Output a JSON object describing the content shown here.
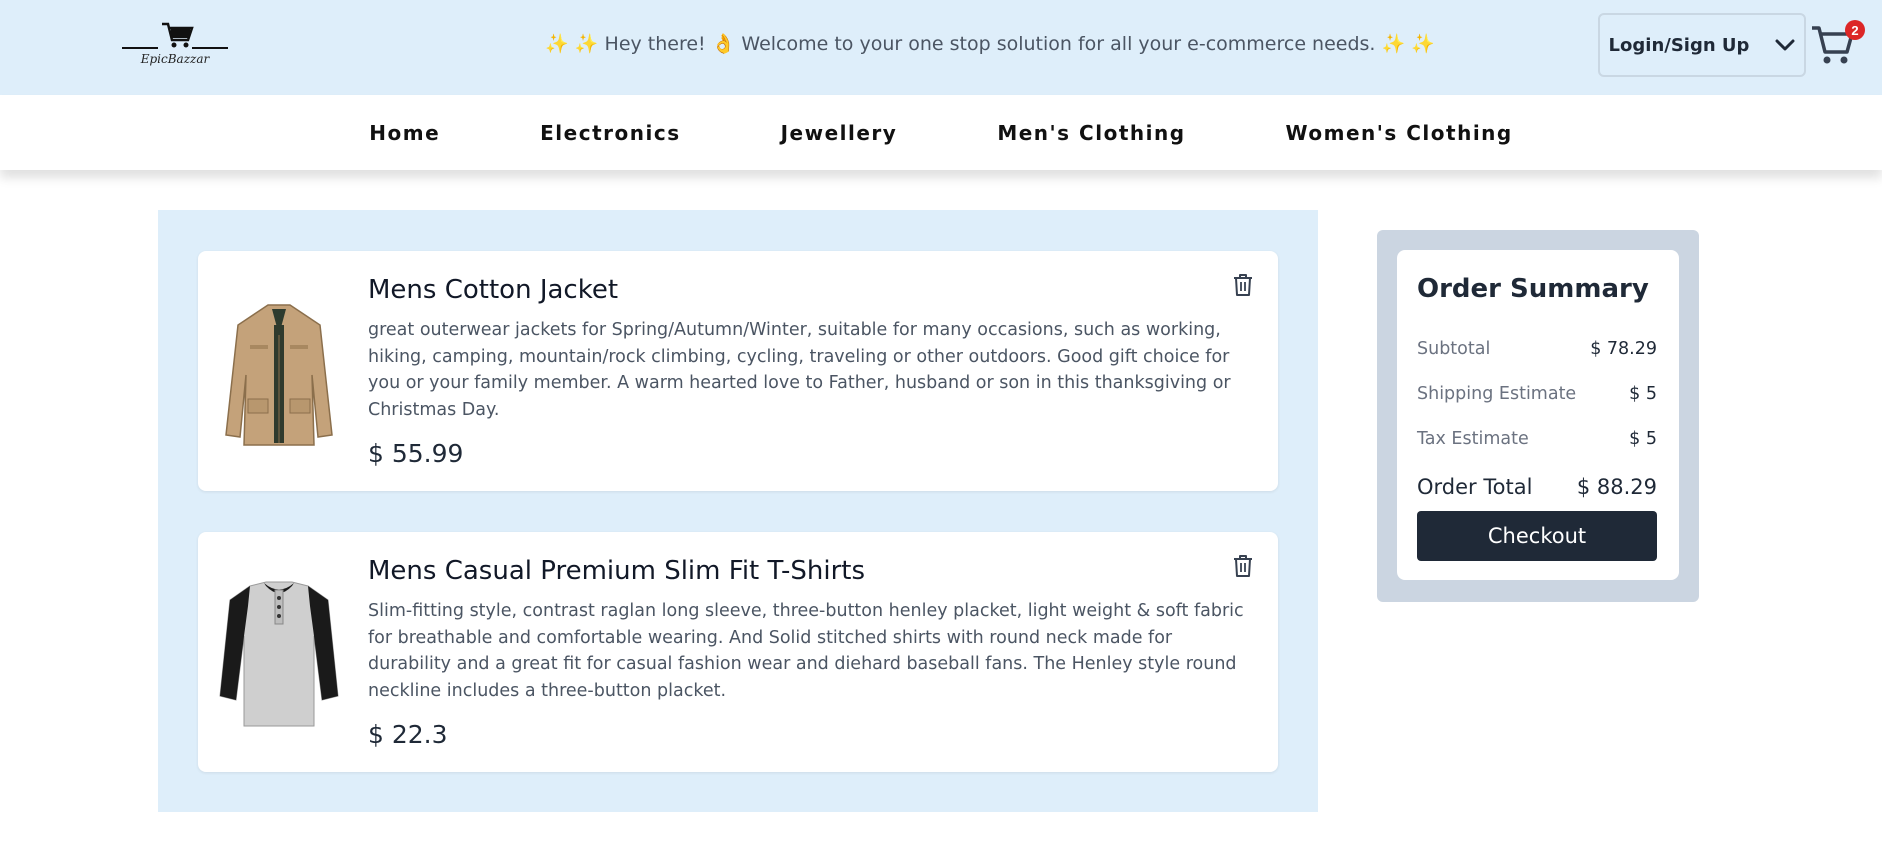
{
  "header": {
    "logo_text": "EpicBazzar",
    "welcome": "✨ ✨ Hey there! 👌 Welcome to your one stop solution for all your e-commerce needs. ✨ ✨",
    "login_label": "Login/Sign Up",
    "cart_count": "2"
  },
  "nav": {
    "items": [
      "Home",
      "Electronics",
      "Jewellery",
      "Men's Clothing",
      "Women's Clothing"
    ]
  },
  "cart": {
    "items": [
      {
        "title": "Mens Cotton Jacket",
        "description": "great outerwear jackets for Spring/Autumn/Winter, suitable for many occasions, such as working, hiking, camping, mountain/rock climbing, cycling, traveling or other outdoors. Good gift choice for you or your family member. A warm hearted love to Father, husband or son in this thanksgiving or Christmas Day.",
        "price": "$ 55.99"
      },
      {
        "title": "Mens Casual Premium Slim Fit T-Shirts",
        "description": "Slim-fitting style, contrast raglan long sleeve, three-button henley placket, light weight & soft fabric for breathable and comfortable wearing. And Solid stitched shirts with round neck made for durability and a great fit for casual fashion wear and diehard baseball fans. The Henley style round neckline includes a three-button placket.",
        "price": "$ 22.3"
      }
    ]
  },
  "summary": {
    "title": "Order Summary",
    "subtotal_label": "Subtotal",
    "subtotal": "$ 78.29",
    "shipping_label": "Shipping Estimate",
    "shipping": "$ 5",
    "tax_label": "Tax Estimate",
    "tax": "$ 5",
    "total_label": "Order Total",
    "total": "$ 88.29",
    "checkout_label": "Checkout"
  },
  "colors": {
    "header_bg": "#deeefa",
    "panel_bg": "#deeefa",
    "summary_bg": "#cbd5e1",
    "button_dark": "#1f2937",
    "badge": "#dc2626"
  },
  "icons": [
    "cart-logo-icon",
    "chevron-down-icon",
    "cart-icon",
    "trash-icon"
  ]
}
